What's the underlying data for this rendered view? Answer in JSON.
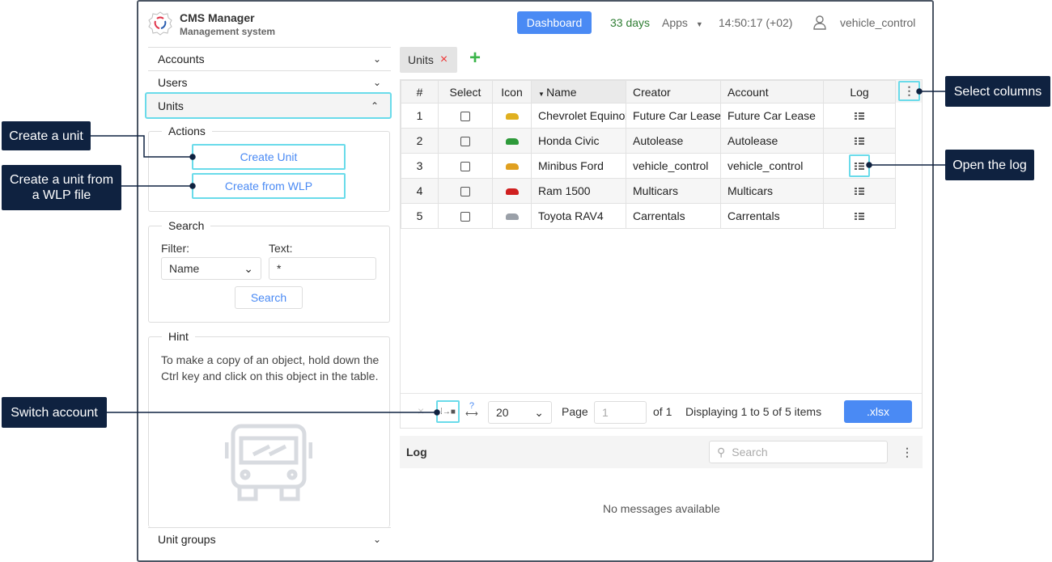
{
  "header": {
    "app_title": "CMS Manager",
    "app_subtitle": "Management system",
    "dashboard": "Dashboard",
    "days": "33 days",
    "apps": "Apps",
    "time": "14:50:17 (+02)",
    "user": "vehicle_control"
  },
  "sidebar": {
    "accounts": "Accounts",
    "users": "Users",
    "units": "Units",
    "unit_groups": "Unit groups",
    "actions_title": "Actions",
    "create_unit": "Create Unit",
    "create_from_wlp": "Create from WLP",
    "search_title": "Search",
    "filter_label": "Filter:",
    "filter_value": "Name",
    "text_label": "Text:",
    "text_value": "*",
    "search_button": "Search",
    "hint_title": "Hint",
    "hint_text": "To make a copy of an object, hold down the Ctrl key and click on this object in the table."
  },
  "tabs": [
    {
      "label": "Units"
    }
  ],
  "table": {
    "headers": [
      "#",
      "Select",
      "Icon",
      "Name",
      "Creator",
      "Account",
      "Log"
    ],
    "rows": [
      {
        "n": "1",
        "name": "Chevrolet Equinox",
        "creator": "Future Car Lease",
        "account": "Future Car Lease",
        "color": "#e0b020"
      },
      {
        "n": "2",
        "name": "Honda Civic",
        "creator": "Autolease",
        "account": "Autolease",
        "color": "#2e9a3a"
      },
      {
        "n": "3",
        "name": "Minibus Ford",
        "creator": "vehicle_control",
        "account": "vehicle_control",
        "color": "#e0a020"
      },
      {
        "n": "4",
        "name": "Ram 1500",
        "creator": "Multicars",
        "account": "Multicars",
        "color": "#d02020"
      },
      {
        "n": "5",
        "name": "Toyota RAV4",
        "creator": "Carrentals",
        "account": "Carrentals",
        "color": "#9aa0a8"
      }
    ]
  },
  "pager": {
    "page_size": "20",
    "page_label": "Page",
    "page_value": "1",
    "of": "of 1",
    "display": "Displaying 1 to 5 of 5 items",
    "export": ".xlsx"
  },
  "log": {
    "title": "Log",
    "search_placeholder": "Search",
    "empty": "No messages available"
  },
  "callouts": {
    "create_unit": "Create a unit",
    "create_wlp": "Create a unit from a WLP file",
    "switch_account": "Switch account",
    "select_columns": "Select columns",
    "open_log": "Open the log"
  },
  "colors": {
    "accent": "#4a8af4",
    "highlight": "#6adbea",
    "callout": "#0f2240",
    "days": "#2e7d32"
  }
}
